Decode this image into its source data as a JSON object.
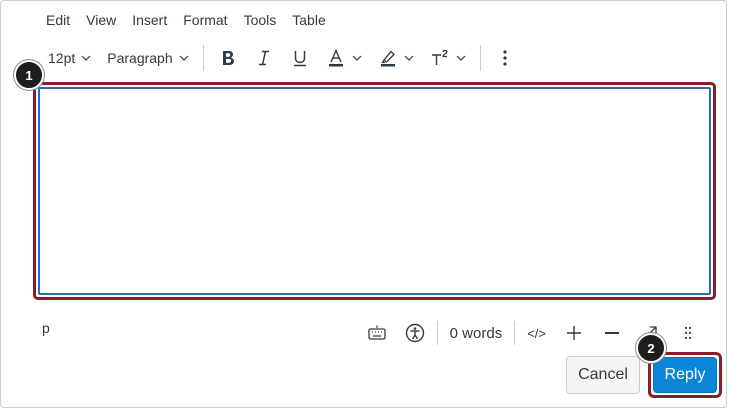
{
  "menubar": {
    "items": [
      "Edit",
      "View",
      "Insert",
      "Format",
      "Tools",
      "Table"
    ]
  },
  "toolbar": {
    "font_size": "12pt",
    "block_format": "Paragraph",
    "icons": [
      "bold-icon",
      "italic-icon",
      "underline-icon",
      "text-color-icon",
      "highlight-icon",
      "superscript-icon",
      "more-vertical-icon"
    ]
  },
  "editor": {
    "content": ""
  },
  "callouts": {
    "editor": "1",
    "reply": "2"
  },
  "statusbar": {
    "path": "p",
    "word_count": "0 words",
    "html_toggle": "</>"
  },
  "actions": {
    "cancel": "Cancel",
    "reply": "Reply"
  },
  "colors": {
    "accent": "#0a86d8",
    "highlight_outline": "#8c1c2a",
    "editor_border": "#2b6bb8"
  }
}
